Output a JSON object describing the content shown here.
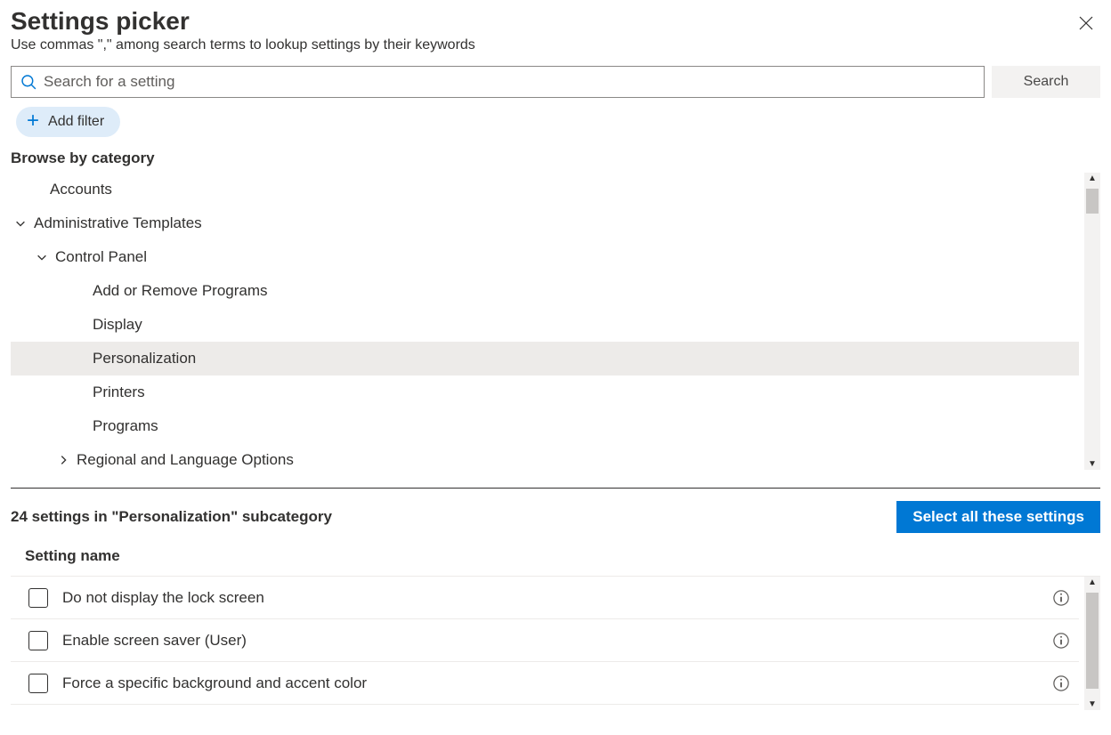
{
  "header": {
    "title": "Settings picker",
    "subtitle": "Use commas \",\" among search terms to lookup settings by their keywords"
  },
  "search": {
    "placeholder": "Search for a setting",
    "button_label": "Search"
  },
  "filter": {
    "add_label": "Add filter"
  },
  "browse": {
    "heading": "Browse by category",
    "items": [
      {
        "label": "Accounts",
        "level": 1,
        "expandable": false,
        "expanded": false,
        "selected": false
      },
      {
        "label": "Administrative Templates",
        "level": 1,
        "expandable": true,
        "expanded": true,
        "selected": false
      },
      {
        "label": "Control Panel",
        "level": 2,
        "expandable": true,
        "expanded": true,
        "selected": false
      },
      {
        "label": "Add or Remove Programs",
        "level": 3,
        "expandable": false,
        "expanded": false,
        "selected": false
      },
      {
        "label": "Display",
        "level": 3,
        "expandable": false,
        "expanded": false,
        "selected": false
      },
      {
        "label": "Personalization",
        "level": 3,
        "expandable": false,
        "expanded": false,
        "selected": true
      },
      {
        "label": "Printers",
        "level": 3,
        "expandable": false,
        "expanded": false,
        "selected": false
      },
      {
        "label": "Programs",
        "level": 3,
        "expandable": false,
        "expanded": false,
        "selected": false
      },
      {
        "label": "Regional and Language Options",
        "level": 3,
        "expandable": true,
        "expanded": false,
        "selected": false
      }
    ]
  },
  "results": {
    "summary": "24 settings in \"Personalization\" subcategory",
    "select_all_label": "Select all these settings",
    "column_header": "Setting name",
    "rows": [
      {
        "label": "Do not display the lock screen"
      },
      {
        "label": "Enable screen saver (User)"
      },
      {
        "label": "Force a specific background and accent color"
      }
    ]
  }
}
